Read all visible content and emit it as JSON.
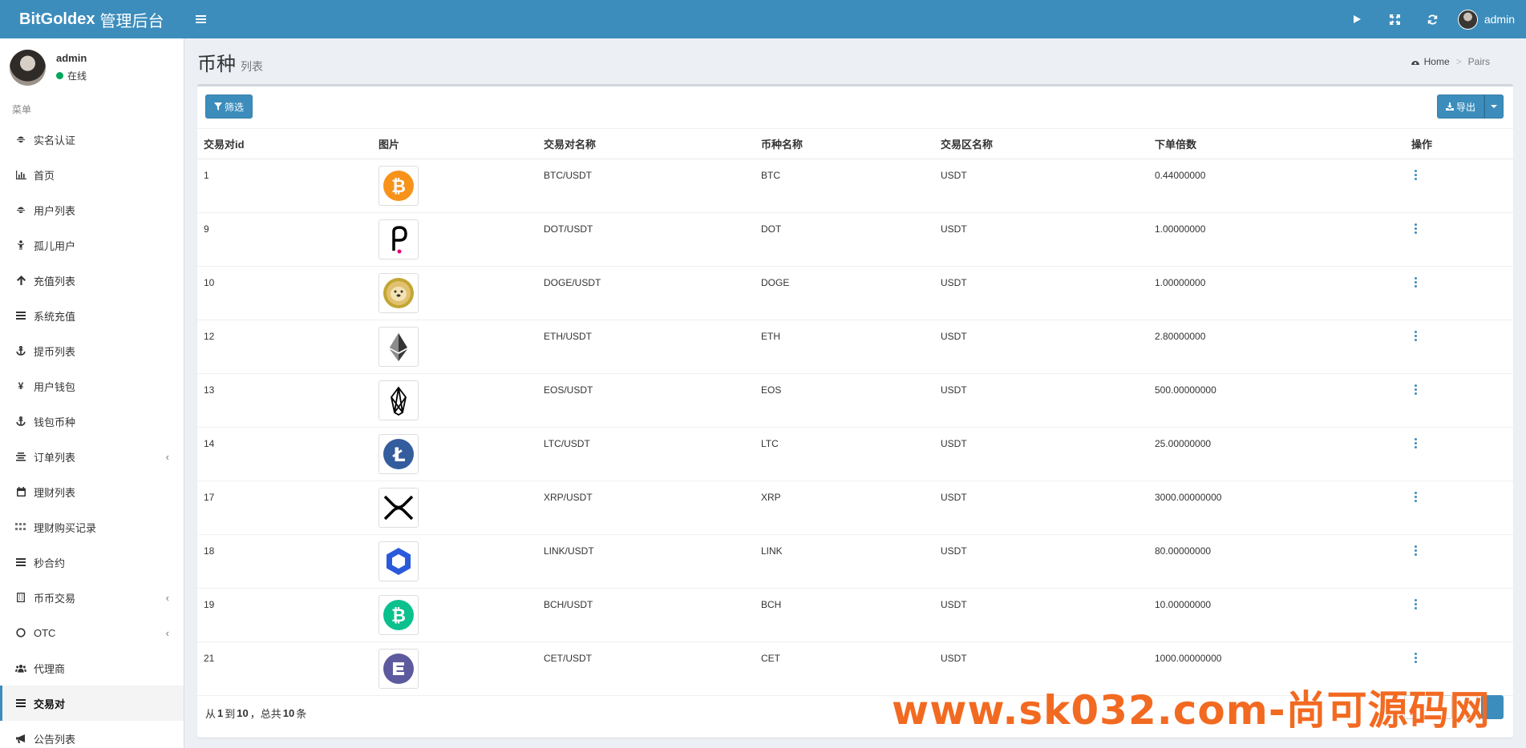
{
  "app": {
    "brand": "BitGoldex",
    "brand_suffix": "管理后台"
  },
  "header": {
    "user_name": "admin"
  },
  "sidebar": {
    "user_name": "admin",
    "user_status": "在线",
    "status_color": "#00a65a",
    "menu_header": "菜单",
    "items": [
      {
        "label": "实名认证",
        "icon": "user-secret-icon"
      },
      {
        "label": "首页",
        "icon": "bar-chart-icon"
      },
      {
        "label": "用户列表",
        "icon": "user-secret-icon"
      },
      {
        "label": "孤儿用户",
        "icon": "child-icon"
      },
      {
        "label": "充值列表",
        "icon": "arrow-up-icon"
      },
      {
        "label": "系统充值",
        "icon": "bars-icon"
      },
      {
        "label": "提币列表",
        "icon": "anchor-icon"
      },
      {
        "label": "用户钱包",
        "icon": "yen-icon"
      },
      {
        "label": "钱包币种",
        "icon": "anchor-icon"
      },
      {
        "label": "订单列表",
        "icon": "align-center-icon"
      },
      {
        "label": "理财列表",
        "icon": "calendar-icon"
      },
      {
        "label": "理财购买记录",
        "icon": "grid-icon"
      },
      {
        "label": "秒合约",
        "icon": "bars-icon"
      },
      {
        "label": "币币交易",
        "icon": "building-icon"
      },
      {
        "label": "OTC",
        "icon": "circle-icon"
      },
      {
        "label": "代理商",
        "icon": "users-icon"
      },
      {
        "label": "交易对",
        "icon": "bars-icon"
      },
      {
        "label": "公告列表",
        "icon": "bullhorn-icon"
      }
    ]
  },
  "page": {
    "title": "币种",
    "subtitle": "列表",
    "breadcrumb_home": "Home",
    "breadcrumb_current": "Pairs"
  },
  "toolbar": {
    "filter_label": "筛选",
    "export_label": "导出"
  },
  "table": {
    "columns": [
      "交易对id",
      "图片",
      "交易对名称",
      "币种名称",
      "交易区名称",
      "下单倍数",
      "操作"
    ],
    "rows": [
      {
        "id": "1",
        "logo": "btc-logo",
        "pair": "BTC/USDT",
        "coin": "BTC",
        "market": "USDT",
        "multiple": "0.44000000"
      },
      {
        "id": "9",
        "logo": "dot-logo",
        "pair": "DOT/USDT",
        "coin": "DOT",
        "market": "USDT",
        "multiple": "1.00000000"
      },
      {
        "id": "10",
        "logo": "doge-logo",
        "pair": "DOGE/USDT",
        "coin": "DOGE",
        "market": "USDT",
        "multiple": "1.00000000"
      },
      {
        "id": "12",
        "logo": "eth-logo",
        "pair": "ETH/USDT",
        "coin": "ETH",
        "market": "USDT",
        "multiple": "2.80000000"
      },
      {
        "id": "13",
        "logo": "eos-logo",
        "pair": "EOS/USDT",
        "coin": "EOS",
        "market": "USDT",
        "multiple": "500.00000000"
      },
      {
        "id": "14",
        "logo": "ltc-logo",
        "pair": "LTC/USDT",
        "coin": "LTC",
        "market": "USDT",
        "multiple": "25.00000000"
      },
      {
        "id": "17",
        "logo": "xrp-logo",
        "pair": "XRP/USDT",
        "coin": "XRP",
        "market": "USDT",
        "multiple": "3000.00000000"
      },
      {
        "id": "18",
        "logo": "link-logo",
        "pair": "LINK/USDT",
        "coin": "LINK",
        "market": "USDT",
        "multiple": "80.00000000"
      },
      {
        "id": "19",
        "logo": "bch-logo",
        "pair": "BCH/USDT",
        "coin": "BCH",
        "market": "USDT",
        "multiple": "10.00000000"
      },
      {
        "id": "21",
        "logo": "cet-logo",
        "pair": "CET/USDT",
        "coin": "CET",
        "market": "USDT",
        "multiple": "1000.00000000"
      }
    ]
  },
  "footer": {
    "prefix": "从",
    "from": "1",
    "mid": "到",
    "to": "10",
    "total_prefix": "，总共",
    "total": "10",
    "suffix": "条"
  },
  "watermark": "www.sk032.com-尚可源码网",
  "colors": {
    "header": "#3c8dbc",
    "primary": "#3c8dbc",
    "watermark": "#f26a21"
  }
}
